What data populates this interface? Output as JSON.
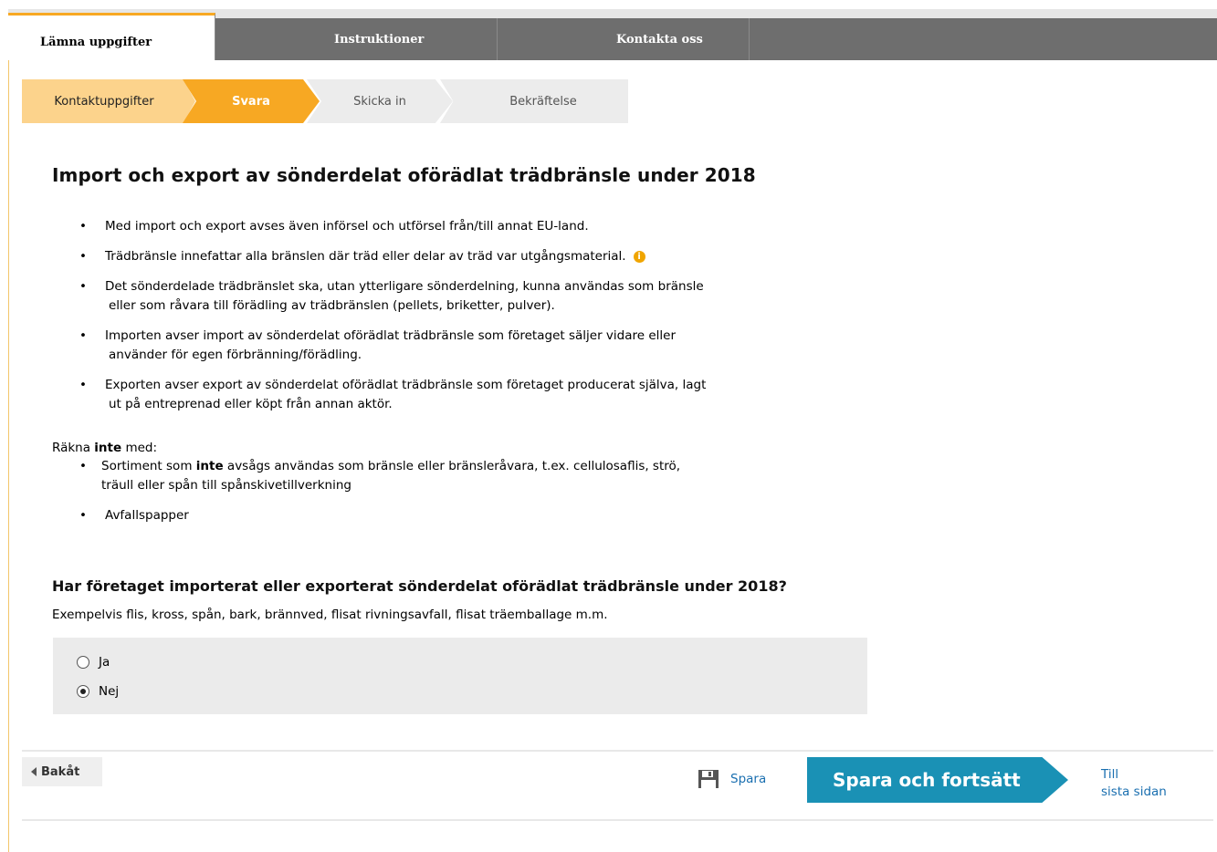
{
  "nav": {
    "tabs": [
      {
        "label": "Lämna uppgifter"
      },
      {
        "label": "Instruktioner"
      },
      {
        "label": "Kontakta oss"
      }
    ]
  },
  "steps": [
    {
      "label": "Kontaktuppgifter"
    },
    {
      "label": "Svara"
    },
    {
      "label": "Skicka in"
    },
    {
      "label": "Bekräftelse"
    }
  ],
  "main": {
    "title": "Import och export av sönderdelat oförädlat trädbränsle under 2018",
    "bullets": [
      {
        "line1": "Med import och export avses även införsel och utförsel från/till annat EU-land."
      },
      {
        "line1": "Trädbränsle innefattar alla bränslen där träd eller delar av träd var utgångsmaterial."
      },
      {
        "line1": "Det sönderdelade trädbränslet ska, utan ytterligare sönderdelning, kunna användas som bränsle",
        "line2": "eller som råvara till förädling av trädbränslen (pellets, briketter, pulver)."
      },
      {
        "line1": "Importen avser import av sönderdelat oförädlat trädbränsle som företaget säljer vidare eller",
        "line2": "använder för egen förbränning/förädling."
      },
      {
        "line1": "Exporten avser export av sönderdelat oförädlat trädbränsle som företaget producerat själva, lagt",
        "line2": "ut på entreprenad eller köpt från annan aktör."
      }
    ],
    "exclude_prefix": "Räkna ",
    "exclude_bold": "inte",
    "exclude_suffix": " med:",
    "exclude_items": [
      {
        "pre": "Sortiment som ",
        "bold": "inte",
        "post": " avsågs användas som bränsle eller bränsleråvara, t.ex. cellulosaflis, strö,",
        "line2": "träull eller spån till spånskivetillverkning"
      },
      {
        "pre": "Avfallspapper"
      }
    ],
    "question": "Har företaget importerat eller exporterat sönderdelat oförädlat trädbränsle under 2018?",
    "example": "Exempelvis flis, kross, spån, bark, brännved, flisat rivningsavfall, flisat träemballage m.m.",
    "options": [
      {
        "label": "Ja",
        "checked": false
      },
      {
        "label": "Nej",
        "checked": true
      }
    ]
  },
  "footer": {
    "back_label": "Bakåt",
    "save_label": "Spara",
    "continue_label": "Spara och fortsätt",
    "last_page_line1": "Till",
    "last_page_line2": "sista sidan"
  },
  "colors": {
    "accent": "#f7a823",
    "step_done": "#fcd38c",
    "continue": "#1a91b5",
    "link": "#1a6fb0",
    "nav_bg": "#6e6e6e"
  },
  "icons": {
    "info": "info-icon",
    "save": "floppy-disk-icon",
    "back": "triangle-left-icon"
  }
}
